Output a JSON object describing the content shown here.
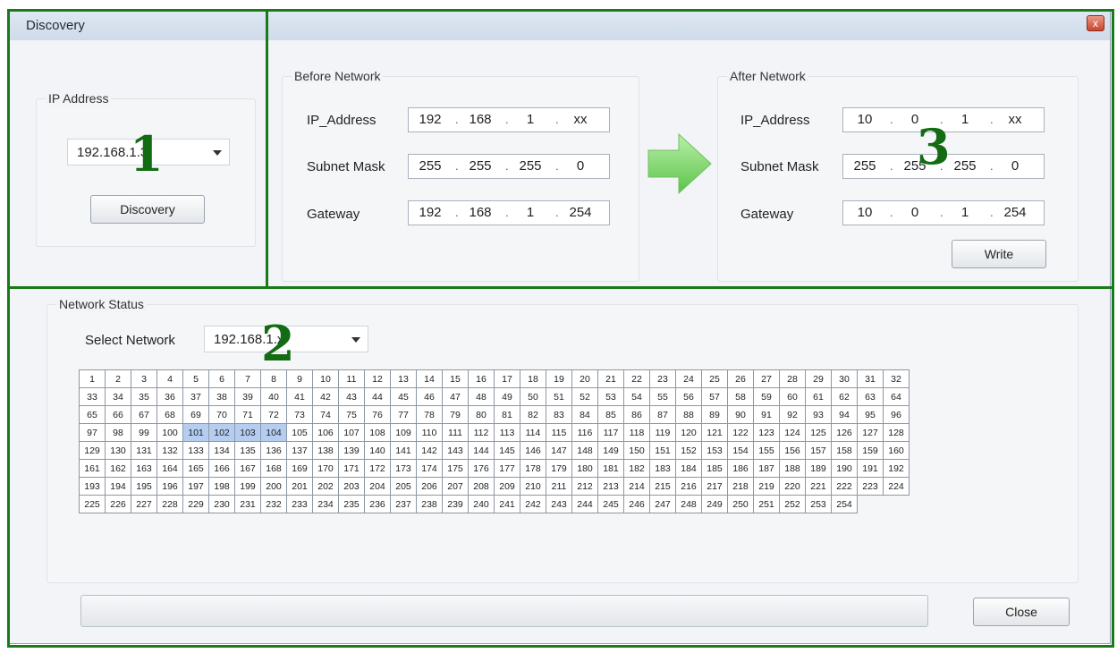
{
  "window": {
    "title": "Discovery",
    "close_label": "x"
  },
  "ip_address": {
    "group_title": "IP Address",
    "selected": "192.168.1.",
    "selected_tail": "3",
    "discovery_button": "Discovery"
  },
  "before_network": {
    "group_title": "Before Network",
    "ip_label": "IP_Address",
    "mask_label": "Subnet Mask",
    "gateway_label": "Gateway",
    "ip": [
      "192",
      "168",
      "1",
      "xx"
    ],
    "mask": [
      "255",
      "255",
      "255",
      "0"
    ],
    "gateway": [
      "192",
      "168",
      "1",
      "254"
    ]
  },
  "after_network": {
    "group_title": "After Network",
    "ip_label": "IP_Address",
    "mask_label": "Subnet Mask",
    "gateway_label": "Gateway",
    "ip": [
      "10",
      "0",
      "1",
      "xx"
    ],
    "mask": [
      "255",
      "255",
      "255",
      "0"
    ],
    "gateway": [
      "10",
      "0",
      "1",
      "254"
    ],
    "write_button": "Write"
  },
  "network_status": {
    "group_title": "Network Status",
    "select_label": "Select Network",
    "selected": "192.168.1.x",
    "cell_max": 254,
    "columns": 32,
    "highlighted": [
      101,
      102,
      103,
      104
    ]
  },
  "close_button": "Close",
  "annotations": [
    "1",
    "2",
    "3"
  ],
  "colors": {
    "annotation": "#187a18",
    "selected_cell": "#b6cdf2",
    "arrow": "#7cd56a"
  }
}
